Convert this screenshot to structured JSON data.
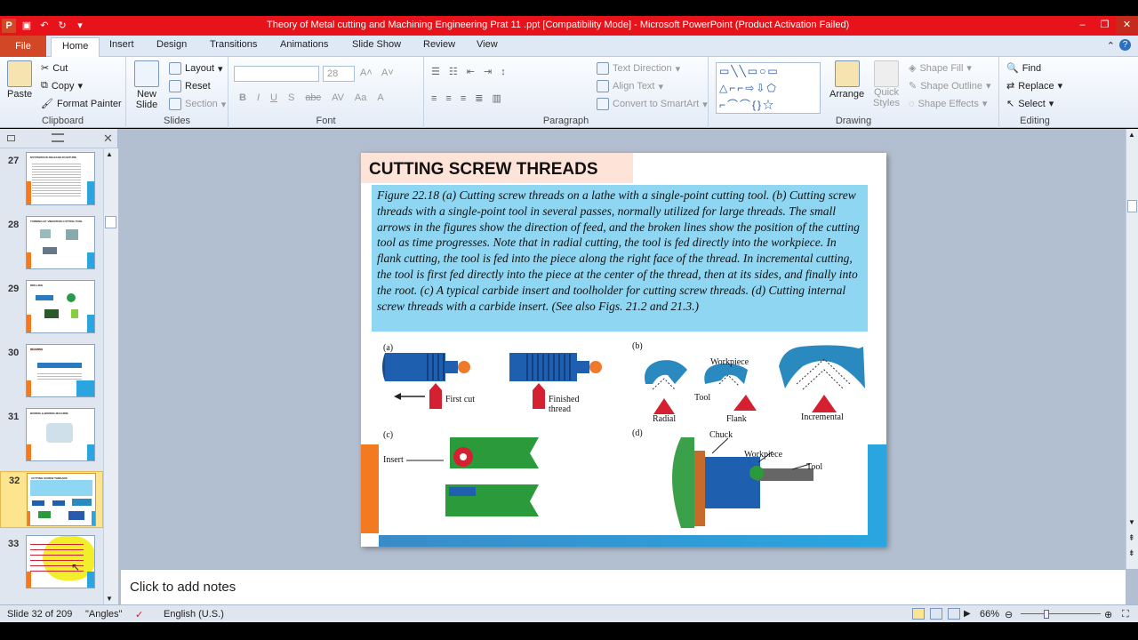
{
  "window": {
    "title": "Theory of Metal cutting and Machining Engineering Prat 11 .ppt [Compatibility Mode] - Microsoft PowerPoint (Product Activation Failed)",
    "app_letter": "P"
  },
  "tabs": [
    "File",
    "Home",
    "Insert",
    "Design",
    "Transitions",
    "Animations",
    "Slide Show",
    "Review",
    "View"
  ],
  "ribbon": {
    "clipboard": {
      "paste": "Paste",
      "cut": "Cut",
      "copy": "Copy",
      "format_painter": "Format Painter",
      "label": "Clipboard"
    },
    "slides": {
      "new_slide": "New Slide",
      "layout": "Layout",
      "reset": "Reset",
      "section": "Section",
      "label": "Slides"
    },
    "font": {
      "size": "28",
      "label": "Font"
    },
    "paragraph": {
      "text_direction": "Text Direction",
      "align_text": "Align Text",
      "convert_smartart": "Convert to SmartArt",
      "label": "Paragraph"
    },
    "drawing": {
      "arrange": "Arrange",
      "quick_styles": "Quick Styles",
      "shape_fill": "Shape Fill",
      "shape_outline": "Shape Outline",
      "shape_effects": "Shape Effects",
      "label": "Drawing"
    },
    "editing": {
      "find": "Find",
      "replace": "Replace",
      "select": "Select",
      "label": "Editing"
    }
  },
  "thumbnails": [
    {
      "num": "27",
      "title": "MYSTERIOUS RELEASE IN NATURE",
      "selected": false
    },
    {
      "num": "28",
      "title": "TURNING BY VIBRATION CUTTING TOOL",
      "selected": false
    },
    {
      "num": "29",
      "title": "DRILLING",
      "selected": false
    },
    {
      "num": "30",
      "title": "REAMING",
      "selected": false
    },
    {
      "num": "31",
      "title": "BORING & BORING MACHINE",
      "selected": false
    },
    {
      "num": "32",
      "title": "CUTTING SCREW THREADS",
      "selected": true
    },
    {
      "num": "33",
      "title": "",
      "selected": false
    }
  ],
  "slide": {
    "title": "CUTTING SCREW THREADS",
    "caption": "Figure 22.18  (a) Cutting screw threads on a lathe with a single-point cutting tool.  (b) Cutting screw threads with a single-point tool in several passes, normally utilized for large threads.  The small arrows in the figures show the direction of feed, and the broken lines show the position of the cutting tool as time progresses.  Note that in radial cutting, the tool is fed directly into the workpiece.  In flank cutting, the tool is fed into the piece along the right face of the thread.  In incremental cutting, the tool is first fed directly into the piece at the center of the thread, then at its sides, and finally into the root.  (c) A typical carbide insert and toolholder for cutting screw threads.  (d) Cutting internal screw threads with a carbide insert.  (See also Figs. 21.2 and 21.3.)",
    "figure": {
      "a": "(a)",
      "first_cut": "First cut",
      "finished_thread": "Finished thread",
      "b": "(b)",
      "workpiece": "Workpiece",
      "tool": "Tool",
      "radial": "Radial",
      "flank": "Flank",
      "incremental": "Incremental",
      "c": "(c)",
      "insert": "Insert",
      "d": "(d)",
      "chuck": "Chuck",
      "workpiece_d": "Workpiece",
      "tool_d": "Tool"
    }
  },
  "notes": {
    "placeholder": "Click to add notes"
  },
  "status": {
    "slide": "Slide 32 of 209",
    "theme": "\"Angles\"",
    "language": "English (U.S.)",
    "zoom": "66%"
  },
  "colors": {
    "title_bar": "#e8121a",
    "caption_bg": "#8fd6f2",
    "title_bg": "#fde3d8",
    "accent_orange": "#f47a22",
    "accent_blue": "#2aa5df"
  }
}
